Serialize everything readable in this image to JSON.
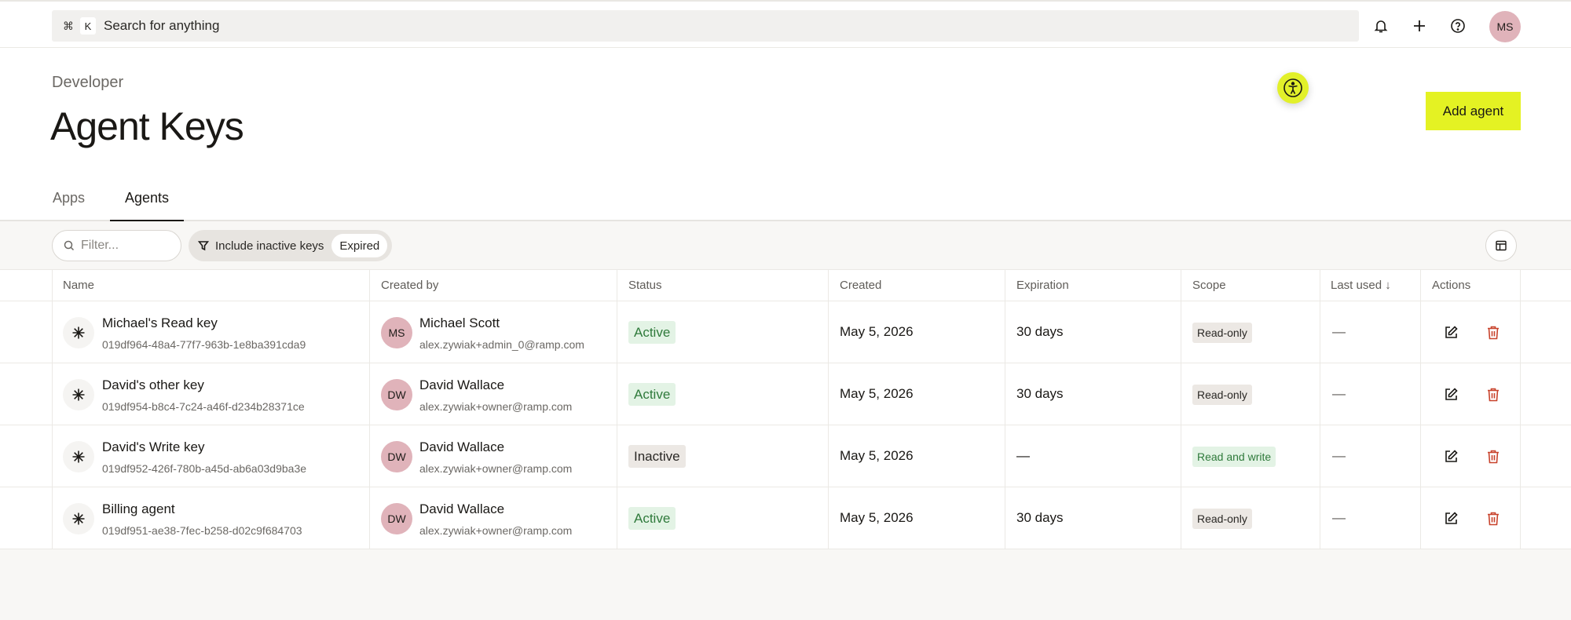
{
  "topbar": {
    "shortcut_cmd": "⌘",
    "shortcut_key": "K",
    "search_label": "Search for anything",
    "user_initials": "MS"
  },
  "header": {
    "breadcrumb": "Developer",
    "title": "Agent Keys",
    "add_button": "Add agent"
  },
  "tabs": [
    {
      "label": "Apps",
      "active": false
    },
    {
      "label": "Agents",
      "active": true
    }
  ],
  "toolbar": {
    "filter_placeholder": "Filter...",
    "chip_label": "Include inactive keys",
    "chip_value": "Expired"
  },
  "table": {
    "headers": {
      "name": "Name",
      "created_by": "Created by",
      "status": "Status",
      "created": "Created",
      "expiration": "Expiration",
      "scope": "Scope",
      "last_used": "Last used ↓",
      "actions": "Actions"
    },
    "rows": [
      {
        "name": "Michael's Read key",
        "id": "019df964-48a4-77f7-963b-1e8ba391cda9",
        "initials": "MS",
        "creator": "Michael Scott",
        "email": "alex.zywiak+admin_0@ramp.com",
        "status": "Active",
        "created": "May 5, 2026",
        "expiration": "30 days",
        "scope": "Read-only",
        "last_used": "—"
      },
      {
        "name": "David's other key",
        "id": "019df954-b8c4-7c24-a46f-d234b28371ce",
        "initials": "DW",
        "creator": "David Wallace",
        "email": "alex.zywiak+owner@ramp.com",
        "status": "Active",
        "created": "May 5, 2026",
        "expiration": "30 days",
        "scope": "Read-only",
        "last_used": "—"
      },
      {
        "name": "David's Write key",
        "id": "019df952-426f-780b-a45d-ab6a03d9ba3e",
        "initials": "DW",
        "creator": "David Wallace",
        "email": "alex.zywiak+owner@ramp.com",
        "status": "Inactive",
        "created": "May 5, 2026",
        "expiration": "—",
        "scope": "Read and write",
        "last_used": "—"
      },
      {
        "name": "Billing agent",
        "id": "019df951-ae38-7fec-b258-d02c9f684703",
        "initials": "DW",
        "creator": "David Wallace",
        "email": "alex.zywiak+owner@ramp.com",
        "status": "Active",
        "created": "May 5, 2026",
        "expiration": "30 days",
        "scope": "Read-only",
        "last_used": "—"
      }
    ]
  },
  "colors": {
    "accent": "#e4f223",
    "avatar": "#e0b3ba",
    "active_bg": "#e3f3e5",
    "active_text": "#2f7a3b",
    "delete": "#c8422b"
  },
  "icons": {
    "bell": "bell-icon",
    "plus": "plus-icon",
    "help": "help-icon",
    "accessibility": "accessibility-icon",
    "filter": "filter-icon",
    "search": "search-icon",
    "columns": "columns-icon",
    "key": "asterisk-icon",
    "edit": "edit-icon",
    "delete": "trash-icon"
  }
}
